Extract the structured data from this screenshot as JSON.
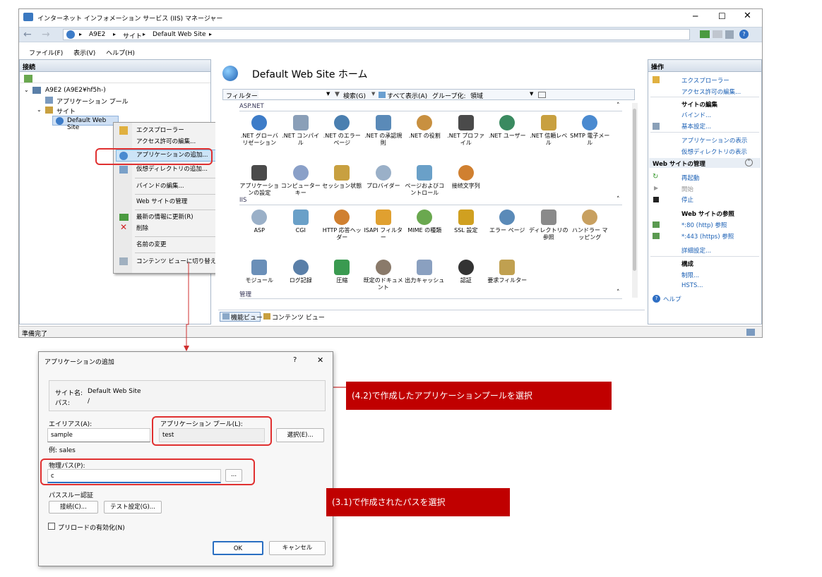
{
  "window": {
    "title": "インターネット インフォメーション サービス (IIS) マネージャー",
    "breadcrumb": [
      "A9E2",
      "サイト",
      "Default Web Site"
    ],
    "menu": [
      "ファイル(F)",
      "表示(V)",
      "ヘルプ(H)"
    ],
    "status": "準備完了"
  },
  "connections": {
    "header": "接続",
    "tree": [
      "A9E2 (A9E2¥hf5h-)",
      "アプリケーション プール",
      "サイト",
      "Default Web Site"
    ]
  },
  "context_menu": {
    "items": [
      "エクスプローラー",
      "アクセス許可の編集...",
      "アプリケーションの追加...",
      "仮想ディレクトリの追加...",
      "バインドの編集...",
      "Web サイトの管理",
      "最新の情報に更新(R)",
      "削除",
      "名前の変更",
      "コンテンツ ビューに切り替え"
    ]
  },
  "center": {
    "title": "Default Web Site ホーム",
    "filter_label": "フィルター:",
    "search": "検索(G)",
    "show_all": "すべて表示(A)",
    "group_by": "グループ化:",
    "group_value": "領域",
    "groups": [
      "ASP.NET",
      "IIS",
      "管理"
    ],
    "aspnet_features": [
      ".NET グローバリゼーション",
      ".NET コンパイル",
      ".NET のエラー ページ",
      ".NET の承認規則",
      ".NET の役割",
      ".NET プロファイル",
      ".NET ユーザー",
      ".NET 信頼レベル",
      "SMTP 電子メール",
      "アプリケーションの設定",
      "コンピューター キー",
      "セッション状態",
      "プロバイダー",
      "ページおよびコントロール",
      "接続文字列"
    ],
    "iis_features": [
      "ASP",
      "CGI",
      "HTTP 応答ヘッダー",
      "ISAPI フィルター",
      "MIME の種類",
      "SSL 設定",
      "エラー ページ",
      "ディレクトリの参照",
      "ハンドラー マッピング",
      "モジュール",
      "ログ記録",
      "圧縮",
      "既定のドキュメント",
      "出力キャッシュ",
      "認証",
      "要求フィルター"
    ],
    "view_tabs": [
      "機能ビュー",
      "コンテンツ ビュー"
    ]
  },
  "actions": {
    "header": "操作",
    "explore": "エクスプローラー",
    "edit_perm": "アクセス許可の編集...",
    "edit_site": "サイトの編集",
    "bindings": "バインド...",
    "basic": "基本設定...",
    "view_apps": "アプリケーションの表示",
    "view_vdirs": "仮想ディレクトリの表示",
    "manage_site": "Web サイトの管理",
    "restart": "再起動",
    "start": "開始",
    "stop": "停止",
    "browse_site": "Web サイトの参照",
    "browse_http": "*:80 (http) 参照",
    "browse_https": "*:443 (https) 参照",
    "advanced": "詳細設定...",
    "config": "構成",
    "limits": "制限...",
    "hsts": "HSTS...",
    "help": "ヘルプ"
  },
  "dialog": {
    "title": "アプリケーションの追加",
    "help": "?",
    "close": "✕",
    "site_name_label": "サイト名:",
    "site_name": "Default Web Site",
    "path_label": "パス:",
    "path": "/",
    "alias_label": "エイリアス(A):",
    "alias": "sample",
    "alias_example": "例: sales",
    "pool_label": "アプリケーション プール(L):",
    "pool": "test",
    "select_button": "選択(E)...",
    "physical_path_label": "物理パス(P):",
    "physical_path": "c",
    "browse_button": "...",
    "pass_through": "パススルー認証",
    "connect_as": "接続(C)...",
    "test_settings": "テスト設定(G)...",
    "preload": "プリロードの有効化(N)",
    "ok": "OK",
    "cancel": "キャンセル"
  },
  "callouts": {
    "pool": "(4.2)で作成したアプリケーションプールを選択",
    "path": "(3.1)で作成されたパスを選択"
  },
  "colors": {
    "callout": "#c00000",
    "highlight": "#e03030",
    "link": "#1a5fb4"
  }
}
